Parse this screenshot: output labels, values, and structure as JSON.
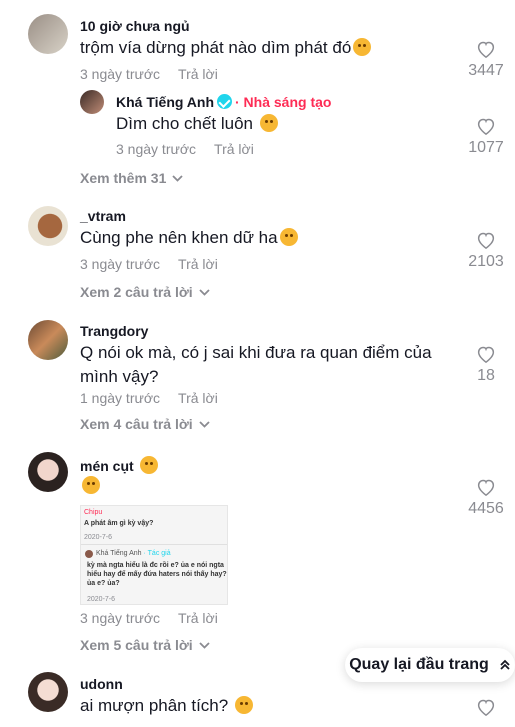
{
  "comments": [
    {
      "username": "10 giờ chưa ngủ",
      "text": "trộm vía dừng phát nào dìm phát đó",
      "time": "3 ngày trước",
      "reply_label": "Trả lời",
      "likes": "3447",
      "emoji": "smiling-face-with-hearts-emoji",
      "reply": {
        "username": "Khá Tiếng Anh",
        "badge": "· Nhà sáng tạo",
        "text": "Dìm cho chết luôn",
        "time": "3 ngày trước",
        "reply_label": "Trả lời",
        "likes": "1077"
      },
      "more_label": "Xem thêm 31"
    },
    {
      "username": "_vtram",
      "text": "Cùng phe nên khen dữ ha",
      "time": "3 ngày trước",
      "reply_label": "Trả lời",
      "likes": "2103",
      "emoji": "tongue-emoji",
      "more_label": "Xem 2 câu trả lời"
    },
    {
      "username": "Trangdory",
      "text": "Q nói ok mà, có j sai khi đưa ra quan điểm của mình vậy?",
      "time": "1 ngày trước",
      "reply_label": "Trả lời",
      "likes": "18",
      "more_label": "Xem 4 câu trả lời"
    },
    {
      "username": "mén cụt",
      "text": "",
      "time": "3 ngày trước",
      "reply_label": "Trả lời",
      "likes": "4456",
      "emoji": "smiling-face-emoji",
      "more_label": "Xem 5 câu trả lời",
      "screenshot": {
        "top_user": "Chipu",
        "top_text": "A phát âm gì kỳ vậy?",
        "top_time": "2020-7-6",
        "reply_user": "Khá Tiếng Anh",
        "reply_badge": "· Tác giả",
        "reply_text": "kỳ mà ngta hiểu là đc rồi e? ủa e nói ngta hiểu hay để mấy đứa haters nói thấy hay? ủa e? ủa?",
        "reply_time": "2020-7-6"
      }
    },
    {
      "username": "udonn",
      "text": "ai mượn phân tích?",
      "emoji": "smiling-face-emoji"
    }
  ],
  "back_to_top": "Quay lại đầu trang",
  "colors": {
    "gray": "#8a8b91",
    "creator": "#fe2c55",
    "text": "#161823"
  }
}
